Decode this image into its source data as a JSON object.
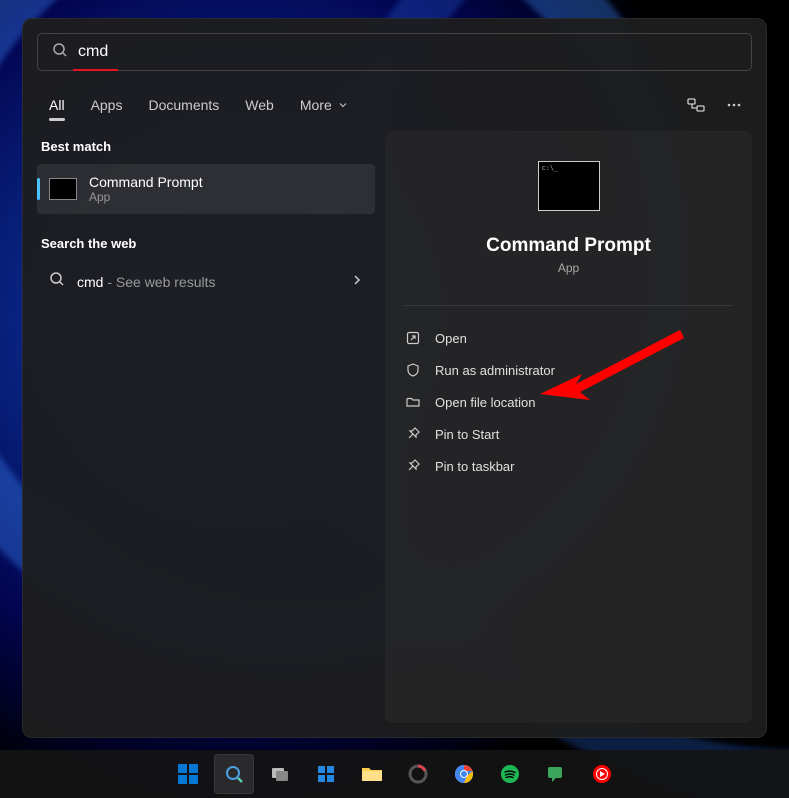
{
  "search": {
    "value": "cmd"
  },
  "filters": {
    "tabs": [
      "All",
      "Apps",
      "Documents",
      "Web",
      "More"
    ]
  },
  "left": {
    "best_match_header": "Best match",
    "best_match": {
      "title": "Command Prompt",
      "subtitle": "App"
    },
    "web_header": "Search the web",
    "web_query": "cmd",
    "web_suffix": " - See web results"
  },
  "preview": {
    "title": "Command Prompt",
    "subtitle": "App",
    "actions": [
      {
        "id": "open",
        "label": "Open"
      },
      {
        "id": "run-admin",
        "label": "Run as administrator"
      },
      {
        "id": "open-location",
        "label": "Open file location"
      },
      {
        "id": "pin-start",
        "label": "Pin to Start"
      },
      {
        "id": "pin-taskbar",
        "label": "Pin to taskbar"
      }
    ]
  }
}
